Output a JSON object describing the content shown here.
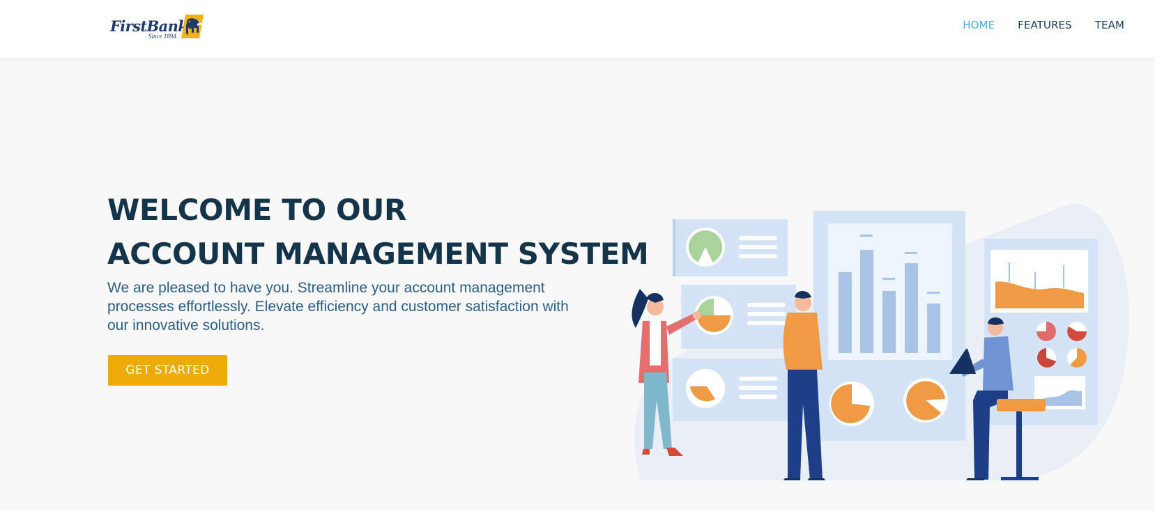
{
  "brand": {
    "name": "FirstBank",
    "tagline": "Since 1894",
    "logo_icon": "elephant-shield-icon",
    "colors": {
      "navy": "#1d3a6c",
      "gold": "#f0b219"
    }
  },
  "nav": {
    "items": [
      {
        "label": "HOME",
        "active": true
      },
      {
        "label": "FEATURES",
        "active": false
      },
      {
        "label": "TEAM",
        "active": false
      }
    ],
    "active_color": "#46aee2",
    "text_color": "#1a3d5a"
  },
  "hero": {
    "title_line1": "WELCOME TO OUR",
    "title_line2": "ACCOUNT MANAGEMENT SYSTEM",
    "subtitle": "We are pleased to have you. Streamline your account management processes effortlessly. Elevate efficiency and customer satisfaction with our innovative solutions.",
    "cta_label": "GET STARTED",
    "cta_color": "#eeaa06",
    "illustration": "team-analytics-dashboard-illustration"
  }
}
